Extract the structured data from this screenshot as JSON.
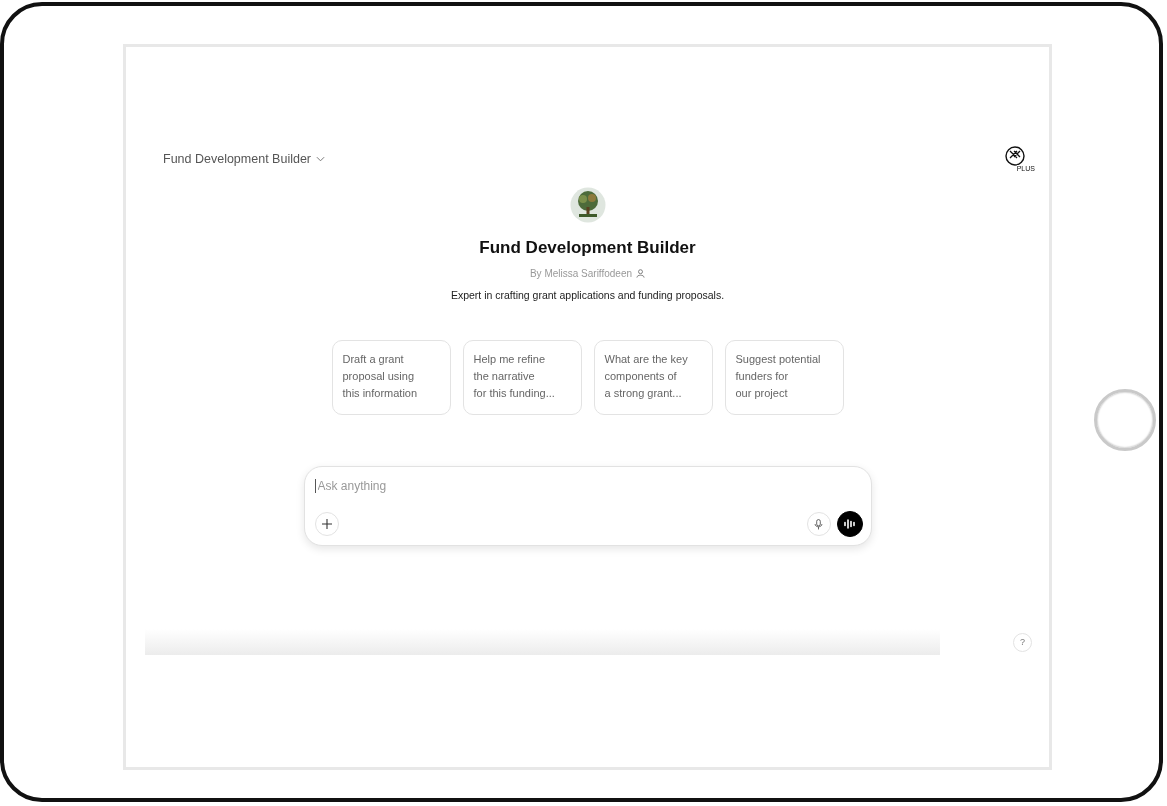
{
  "header": {
    "title": "Fund Development Builder",
    "badge_text": "PLUS"
  },
  "gpt": {
    "name": "Fund Development Builder",
    "author": "By Melissa Sariffodeen",
    "description": "Expert in crafting grant applications and funding proposals."
  },
  "suggestions": [
    {
      "lines": [
        "Draft a grant",
        "proposal using",
        "this information"
      ]
    },
    {
      "lines": [
        "Help me refine",
        "the narrative",
        "for this funding..."
      ]
    },
    {
      "lines": [
        "What are the key",
        "components of",
        "a strong grant..."
      ]
    },
    {
      "lines": [
        "Suggest potential",
        "funders for",
        "our project"
      ]
    }
  ],
  "composer": {
    "placeholder": "Ask anything"
  },
  "help": "?"
}
